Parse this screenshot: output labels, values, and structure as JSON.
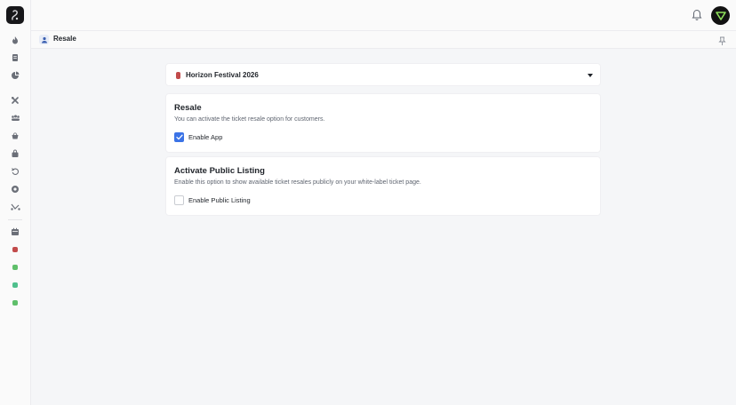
{
  "header": {
    "page_title": "Resale"
  },
  "event_selector": {
    "selected": "Horizon Festival 2026",
    "event_color": "#c24b4b"
  },
  "resale_section": {
    "title": "Resale",
    "description": "You can activate the ticket resale option for customers.",
    "checkbox_label": "Enable App",
    "checked": true
  },
  "public_listing_section": {
    "title": "Activate Public Listing",
    "description": "Enable this option to show available ticket resales publicly on your white-label ticket page.",
    "checkbox_label": "Enable Public Listing",
    "checked": false
  },
  "sidebar": {
    "icons": [
      "fire-icon",
      "document-icon",
      "pie-chart-icon",
      "tools-icon",
      "users-icon",
      "basket-icon",
      "bag-icon",
      "undo-icon",
      "settings-icon",
      "route-icon",
      "calendar-icon"
    ],
    "event_dots": [
      "#c24b4b",
      "#5fbf6a",
      "#4fc08d",
      "#5fbf6a"
    ]
  },
  "colors": {
    "accent": "#3b73e6",
    "background": "#f5f6f8"
  }
}
